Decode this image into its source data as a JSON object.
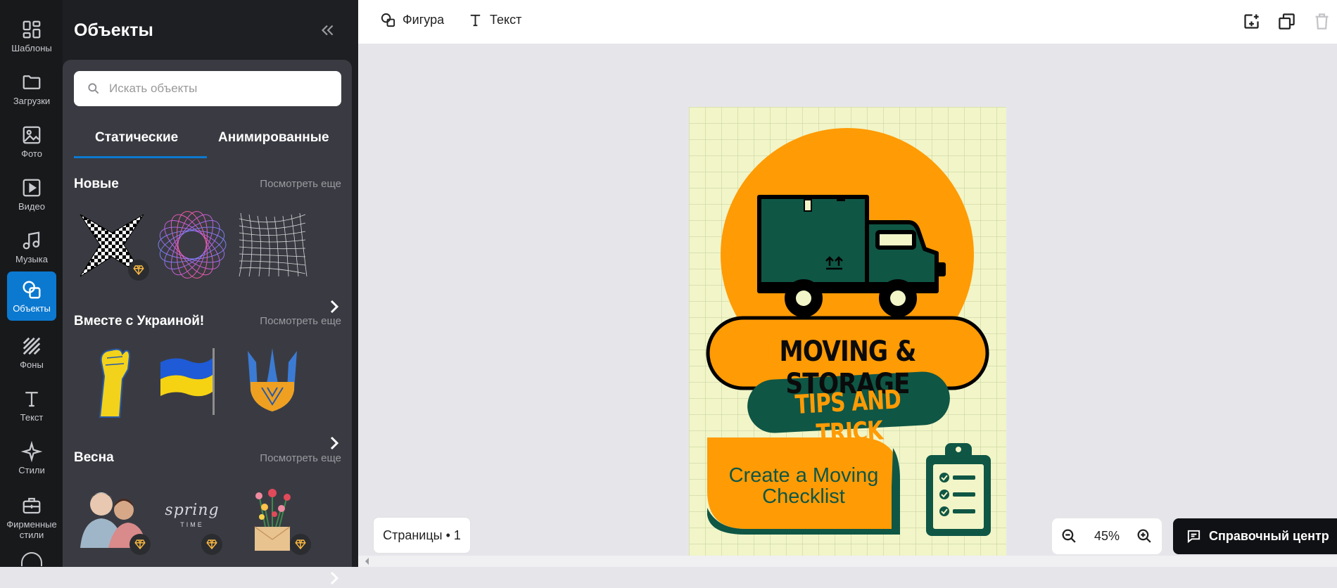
{
  "rail": {
    "items": [
      {
        "label": "Шаблоны",
        "icon": "grid-icon"
      },
      {
        "label": "Загрузки",
        "icon": "folder-icon"
      },
      {
        "label": "Фото",
        "icon": "image-icon"
      },
      {
        "label": "Видео",
        "icon": "video-icon"
      },
      {
        "label": "Музыка",
        "icon": "music-icon"
      },
      {
        "label": "Объекты",
        "icon": "shapes-icon",
        "active": true
      },
      {
        "label": "Фоны",
        "icon": "stripes-icon"
      },
      {
        "label": "Текст",
        "icon": "text-icon"
      },
      {
        "label": "Стили",
        "icon": "sparkle-icon"
      },
      {
        "label": "Фирменные стили",
        "icon": "briefcase-icon"
      }
    ]
  },
  "panel": {
    "title": "Объекты",
    "search_placeholder": "Искать объекты",
    "tabs": [
      "Статические",
      "Анимированные"
    ],
    "sections": [
      {
        "title": "Новые",
        "more": "Посмотреть еще"
      },
      {
        "title": "Вместе с Украиной!",
        "more": "Посмотреть еще"
      },
      {
        "title": "Весна",
        "more": "Посмотреть еще"
      }
    ],
    "spring_text": "spring",
    "spring_sub": "TIME"
  },
  "toolbar": {
    "shape_label": "Фигура",
    "text_label": "Текст"
  },
  "poster": {
    "title": "MOVING & STORAGE",
    "subtitle": "TIPS AND TRICK",
    "item1_line1": "Create a Moving",
    "item1_line2": "Checklist"
  },
  "bottom": {
    "pages_label": "Страницы • 1",
    "zoom": "45%",
    "help_label": "Справочный центр"
  },
  "colors": {
    "accent": "#0b79d0",
    "poster_bg": "#f1f5c7",
    "poster_orange": "#ff9b05",
    "poster_green": "#0f5645"
  }
}
